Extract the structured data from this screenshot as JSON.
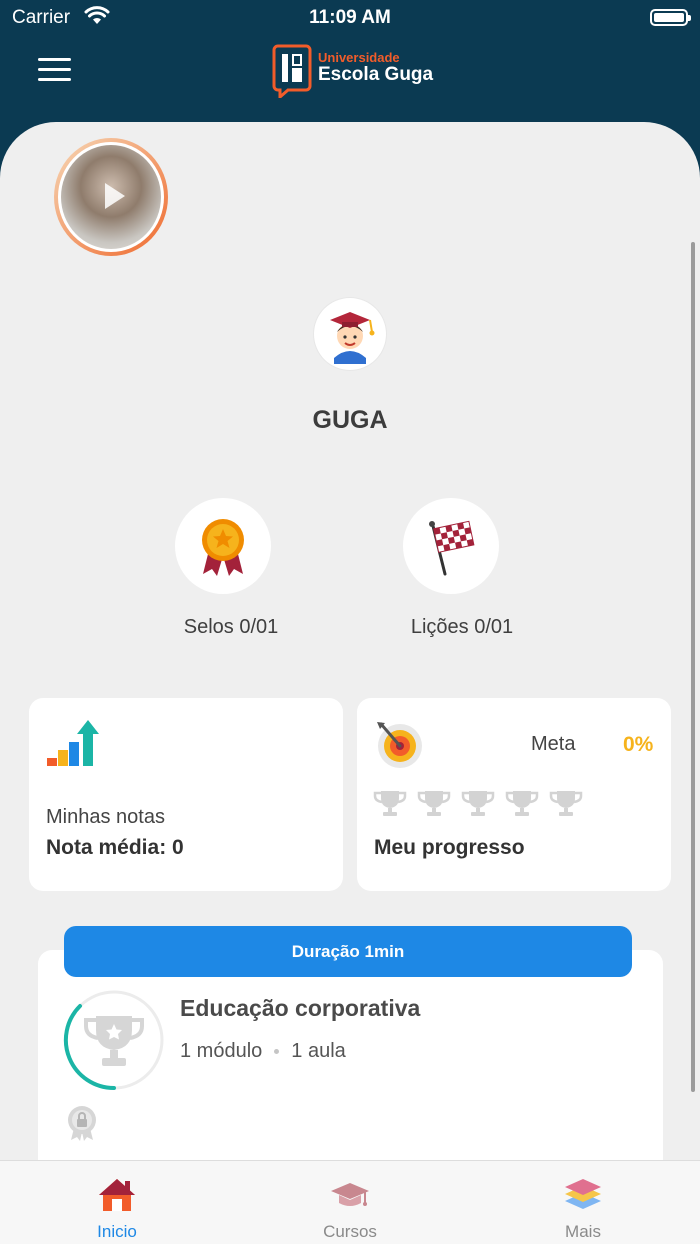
{
  "status_bar": {
    "carrier": "Carrier",
    "time": "11:09 AM"
  },
  "header": {
    "logo_top": "Universidade",
    "logo_bottom": "Escola Guga"
  },
  "profile": {
    "name": "GUGA"
  },
  "stats": {
    "selos": "Selos 0/01",
    "licoes": "Lições 0/01"
  },
  "notes_card": {
    "subtitle": "Minhas notas",
    "average": "Nota média: 0"
  },
  "progress_card": {
    "goal_label": "Meta",
    "goal_percent": "0%",
    "title": "Meu progresso",
    "trophy_count": 5
  },
  "course": {
    "duration": "Duração 1min",
    "title": "Educação corporativa",
    "modules": "1 módulo",
    "lessons": "1 aula"
  },
  "tabs": [
    {
      "label": "Inicio",
      "active": true
    },
    {
      "label": "Cursos",
      "active": false
    },
    {
      "label": "Mais",
      "active": false
    }
  ],
  "colors": {
    "header_bg": "#0b3a52",
    "accent": "#1e88e5",
    "brand_orange": "#f25c2a",
    "goal_yellow": "#f6b31c",
    "progress_teal": "#1bb5a6"
  }
}
